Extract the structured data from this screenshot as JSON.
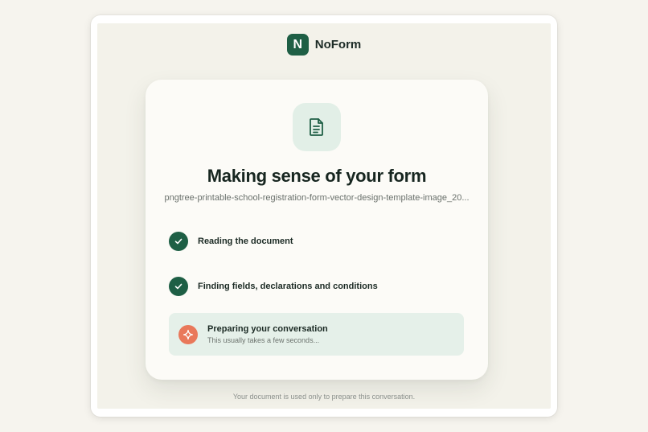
{
  "brand": {
    "logo_letter": "N",
    "name": "NoForm"
  },
  "card": {
    "icon": "document-icon",
    "title": "Making sense of your form",
    "filename": "pngtree-printable-school-registration-form-vector-design-template-image_20..."
  },
  "steps": [
    {
      "label": "Reading the document",
      "status": "done",
      "icon": "check-icon"
    },
    {
      "label": "Finding fields, declarations and conditions",
      "status": "done",
      "icon": "check-icon"
    },
    {
      "label": "Preparing your conversation",
      "status": "in-progress",
      "icon": "sparkle-icon",
      "sublabel": "This usually takes a few seconds..."
    }
  ],
  "footer": {
    "note": "Your document is used only to prepare this conversation."
  },
  "colors": {
    "brand_green": "#1e5f45",
    "accent_orange": "#e9785a",
    "active_step_bg": "#e5f0e9",
    "page_bg": "#f3f2ea"
  }
}
